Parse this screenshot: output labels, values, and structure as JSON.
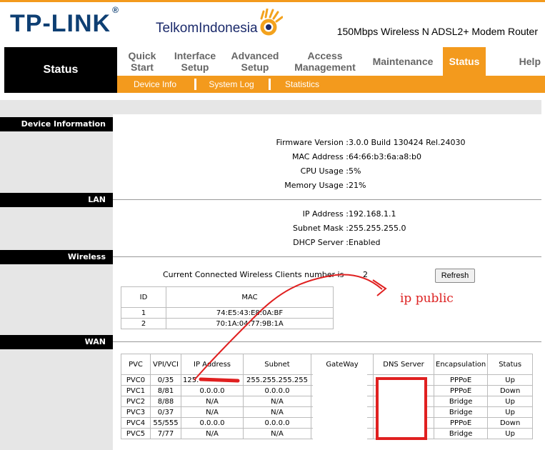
{
  "header": {
    "logo_tplink": "TP-LINK",
    "logo_reg": "®",
    "logo_telkom": "TelkomIndonesia",
    "model": "150Mbps Wireless N ADSL2+ Modem Router",
    "brand_color": "#f39a1d"
  },
  "nav": {
    "current_section": "Status",
    "tabs": [
      {
        "label": "Quick\nStart"
      },
      {
        "label": "Interface\nSetup"
      },
      {
        "label": "Advanced\nSetup"
      },
      {
        "label": "Access\nManagement"
      },
      {
        "label": "Maintenance"
      },
      {
        "label": "Status",
        "active": true
      },
      {
        "label": "Help"
      }
    ],
    "subtabs": [
      "Device Info",
      "System Log",
      "Statistics"
    ]
  },
  "sections": {
    "device": {
      "title": "Device Information",
      "rows": [
        {
          "label": "Firmware Version :",
          "value": "3.0.0 Build 130424 Rel.24030"
        },
        {
          "label": "MAC Address :",
          "value": "64:66:b3:6a:a8:b0"
        },
        {
          "label": "CPU Usage :",
          "value": "5%"
        },
        {
          "label": "Memory Usage :",
          "value": "21%"
        }
      ]
    },
    "lan": {
      "title": "LAN",
      "rows": [
        {
          "label": "IP Address :",
          "value": "192.168.1.1"
        },
        {
          "label": "Subnet Mask :",
          "value": "255.255.255.0"
        },
        {
          "label": "DHCP Server :",
          "value": "Enabled"
        }
      ]
    },
    "wireless": {
      "title": "Wireless",
      "clients_text": "Current Connected Wireless Clients number is",
      "clients_count": "2",
      "refresh_label": "Refresh",
      "table_headers": [
        "ID",
        "MAC"
      ],
      "table_rows": [
        [
          "1",
          "74:E5:43:E8:0A:BF"
        ],
        [
          "2",
          "70:1A:04:77:9B:1A"
        ]
      ]
    },
    "wan": {
      "title": "WAN",
      "table_headers": [
        "PVC",
        "VPI/VCI",
        "IP Address",
        "Subnet",
        "GateWay",
        "DNS Server",
        "Encapsulation",
        "Status"
      ],
      "table_rows": [
        [
          "PVC0",
          "0/35",
          "125.",
          "255.255.255.255",
          "",
          "",
          "PPPoE",
          "Up"
        ],
        [
          "PVC1",
          "8/81",
          "0.0.0.0",
          "0.0.0.0",
          "",
          "",
          "PPPoE",
          "Down"
        ],
        [
          "PVC2",
          "8/88",
          "N/A",
          "N/A",
          "",
          "",
          "Bridge",
          "Up"
        ],
        [
          "PVC3",
          "0/37",
          "N/A",
          "N/A",
          "",
          "",
          "Bridge",
          "Up"
        ],
        [
          "PVC4",
          "55/555",
          "0.0.0.0",
          "0.0.0.0",
          "",
          "",
          "PPPoE",
          "Down"
        ],
        [
          "PVC5",
          "7/77",
          "N/A",
          "N/A",
          "",
          "",
          "Bridge",
          "Up"
        ]
      ]
    }
  },
  "annotation": {
    "text": "ip public",
    "color": "#d22222"
  }
}
